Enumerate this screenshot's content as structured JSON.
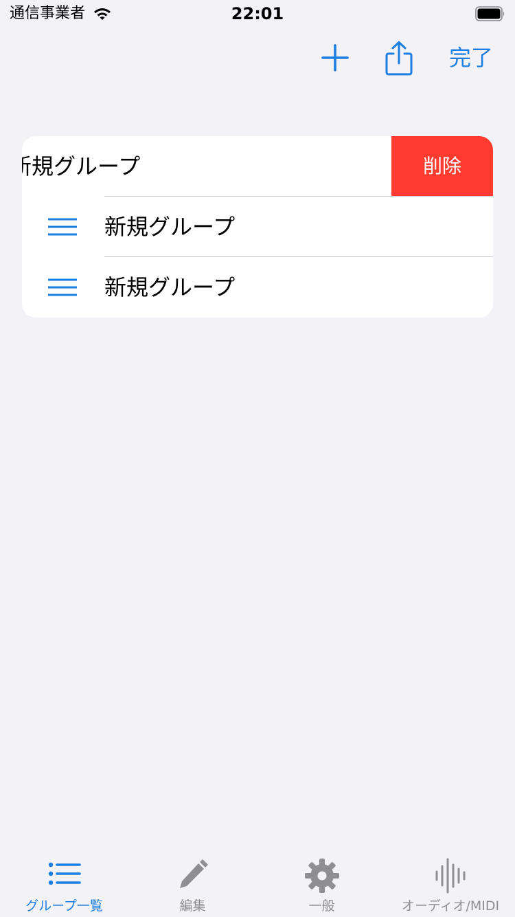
{
  "colors": {
    "accent": "#1b7ee0",
    "destructive": "#ff3b30",
    "background": "#f2f2f7",
    "inactive": "#8e8e93"
  },
  "status_bar": {
    "carrier": "通信事業者",
    "time": "22:01",
    "wifi_icon": "wifi-icon",
    "battery_icon": "battery-icon"
  },
  "nav": {
    "add_icon": "plus-icon",
    "share_icon": "share-icon",
    "done_label": "完了"
  },
  "groups": [
    {
      "title": "新規グループ",
      "delete_label": "削除"
    },
    {
      "title": "新規グループ"
    },
    {
      "title": "新規グループ"
    }
  ],
  "tabs": [
    {
      "label": "グループ一覧",
      "icon": "list-icon",
      "active": true
    },
    {
      "label": "編集",
      "icon": "pencil-icon",
      "active": false
    },
    {
      "label": "一般",
      "icon": "gear-icon",
      "active": false
    },
    {
      "label": "オーディオ/MIDI",
      "icon": "waveform-icon",
      "active": false
    }
  ]
}
